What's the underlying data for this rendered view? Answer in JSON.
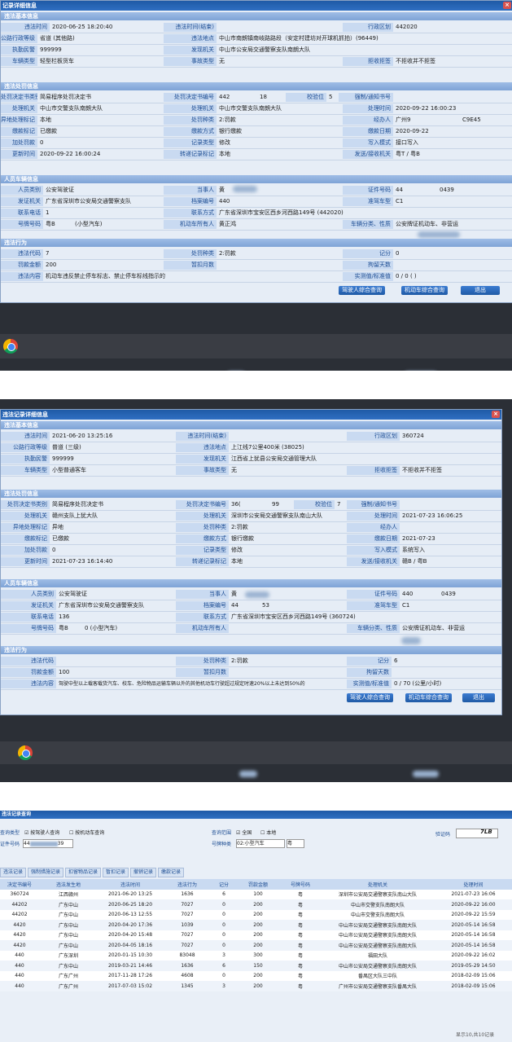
{
  "shot1": {
    "title": "记录详细信息",
    "sections": {
      "basic": "违法基本信息",
      "penalty": "违法处罚信息",
      "person": "人员车辆信息",
      "behavior": "违法行为"
    },
    "violation_time_label": "违法时间",
    "violation_time": "2020-06-25 18:20:40",
    "violation_time_end_label": "违法时间(结束)",
    "admin_area_label": "行政区划",
    "admin_area": "442020",
    "road_level_label": "公路行政等级",
    "road_level": "省道 (其他路)",
    "location_label": "违法地点",
    "location": "中山市南朗镇南岐路路段（安定村建坊对开球机抓拍）(96449)",
    "officer_label": "执勤民警",
    "officer": "999999",
    "found_org_label": "发现机关",
    "found_org": "中山市公安局交通警察支队南朗大队",
    "vehicle_type_label": "车辆类型",
    "vehicle_type": "轻型栏板货车",
    "accident_label": "事故类型",
    "accident": "无",
    "refuse_label": "拒收拒签",
    "refuse": "不拒收并不拒签",
    "decision_type_label": "处罚决定书类别",
    "decision_type": "简易程序处罚决定书",
    "decision_no_label": "处罚决定书编号",
    "decision_no_a": "442",
    "decision_no_b": "18",
    "check_label": "校验位",
    "check": "5",
    "notice_label": "强制/通知书号",
    "handle_org_label": "处理机关",
    "handle_org": "中山市交警支队南朗大队",
    "handle_org2": "中山市交警支队南朗大队",
    "handle_time_label": "处理时间",
    "handle_time": "2020-09-22 16:00:23",
    "remote_label": "异地处理标记",
    "remote": "本地",
    "penalty_kind_label": "处罚种类",
    "penalty_kind": "2:罚款",
    "handler_label": "经办人",
    "handler_a": "广州9",
    "handler_b": "C9E45",
    "pay_flag_label": "缴款标记",
    "pay_flag": "已缴款",
    "pay_method_label": "缴款方式",
    "pay_method": "银行缴款",
    "pay_date_label": "缴款日期",
    "pay_date": "2020-09-22",
    "late_fee_label": "加处罚款",
    "late_fee": "0",
    "record_type_label": "记录类型",
    "record_type": "修改",
    "write_mode_label": "写入模式",
    "write_mode": "接口写入",
    "update_time_label": "更新时间",
    "update_time": "2020-09-22 16:00:24",
    "transfer_label": "转递记录标记",
    "transfer": "本地",
    "send_recv_label": "发送/接收机关",
    "send_recv": "粤T / 粤B",
    "person_type_label": "人员类别",
    "person_type": "公安驾驶证",
    "party_label": "当事人",
    "party": "黄",
    "license_no_label": "证件号码",
    "license_no_a": "44",
    "license_no_b": "0439",
    "issuer_label": "发证机关",
    "issuer": "广东省深圳市公安局交通警察支队",
    "file_no_label": "档案编号",
    "file_no": "440",
    "quasi_label": "准驾车型",
    "quasi": "C1",
    "phone_label": "联系电话",
    "phone": "1",
    "address_label": "联系方式",
    "address": "广东省深圳市宝安区西乡河西路149号 (442020)",
    "plate_label": "号牌号码",
    "plate_a": "粤B",
    "plate_b": "(小型汽车)",
    "owner_label": "机动车所有人",
    "owner": "黄正鸿",
    "usage_label": "车辆分类、性质",
    "usage": "公安牌证机动车、非营运",
    "code_label": "违法代码",
    "code": "7",
    "score_label": "记分",
    "score": "0",
    "penalty_kind2_label": "处罚种类",
    "penalty_kind2": "2:罚款",
    "fine_label": "罚款金额",
    "fine": "200",
    "detain_label": "暂扣月数",
    "detain_days_label": "拘留天数",
    "content_label": "违法内容",
    "content": "机动车违反禁止停车标志、禁止停车标线指示的",
    "measure_label": "实测值/标准值",
    "measure": "0 / 0 ( )",
    "btn_driver": "驾驶人综合查询",
    "btn_vehicle": "机动车综合查询",
    "btn_exit": "退出"
  },
  "shot2": {
    "title": "违法记录详细信息",
    "sections": {
      "basic": "违法基本信息",
      "penalty": "违法处罚信息",
      "person": "人员车辆信息",
      "behavior": "违法行为"
    },
    "violation_time_label": "违法时间",
    "violation_time": "2021-06-20 13:25:16",
    "violation_time_end_label": "违法时间(结束)",
    "admin_area_label": "行政区划",
    "admin_area": "360724",
    "road_level_label": "公路行政等级",
    "road_level": "普道 (三级)",
    "location_label": "违法地点",
    "location": "上江线7公里400米 (38025)",
    "officer_label": "执勤民警",
    "officer": "999999",
    "found_org_label": "发现机关",
    "found_org": "江西省上犹县公安局交通管理大队",
    "vehicle_type_label": "车辆类型",
    "vehicle_type": "小型普通客车",
    "accident_label": "事故类型",
    "accident": "无",
    "refuse_label": "拒收拒签",
    "refuse": "不拒收并不拒签",
    "decision_type_label": "处罚决定书类别",
    "decision_type": "简易程序处罚决定书",
    "decision_no_label": "处罚决定书编号",
    "decision_no_a": "36(",
    "decision_no_b": "99",
    "check_label": "校验位",
    "check": "7",
    "notice_label": "强制/通知书号",
    "handle_org_label": "处理机关",
    "handle_org": "赣州支队上犹大队",
    "handle_org2": "深圳市公安局交通警察支队南山大队",
    "handle_time_label": "处理时间",
    "handle_time": "2021-07-23 16:06:25",
    "remote_label": "异地处理标记",
    "remote": "异地",
    "penalty_kind_label": "处罚种类",
    "penalty_kind": "2:罚款",
    "handler_label": "经办人",
    "pay_flag_label": "缴款标记",
    "pay_flag": "已缴款",
    "pay_method_label": "缴款方式",
    "pay_method": "银行缴款",
    "pay_date_label": "缴款日期",
    "pay_date": "2021-07-23",
    "late_fee_label": "加处罚款",
    "late_fee": "0",
    "record_type_label": "记录类型",
    "record_type": "修改",
    "write_mode_label": "写入模式",
    "write_mode": "系统写入",
    "update_time_label": "更新时间",
    "update_time": "2021-07-23 16:14:40",
    "transfer_label": "转递记录标记",
    "transfer": "本地",
    "send_recv_label": "发送/接收机关",
    "send_recv": "赣B / 粤B",
    "person_type_label": "人员类别",
    "person_type": "公安驾驶证",
    "party_label": "当事人",
    "party": "黄",
    "license_no_label": "证件号码",
    "license_no_a": "440",
    "license_no_b": "0439",
    "issuer_label": "发证机关",
    "issuer": "广东省深圳市公安局交通警察支队",
    "file_no_label": "档案编号",
    "file_no_a": "44",
    "file_no_b": "53",
    "quasi_label": "准驾车型",
    "quasi": "C1",
    "phone_label": "联系电话",
    "phone": "136",
    "address_label": "联系方式",
    "address": "广东省深圳市宝安区西乡河西路149号 (360724)",
    "plate_label": "号牌号码",
    "plate_a": "粤B",
    "plate_b": "0 (小型汽车)",
    "owner_label": "机动车所有人",
    "usage_label": "车辆分类、性质",
    "usage": "公安牌证机动车、非营运",
    "code_label": "违法代码",
    "score_label": "记分",
    "score": "6",
    "penalty_kind2_label": "处罚种类",
    "penalty_kind2": "2:罚款",
    "fine_label": "罚款金额",
    "fine": "100",
    "detain_label": "暂扣月数",
    "detain_days_label": "拘留天数",
    "content_label": "违法内容",
    "content": "驾驶中型以上载客载货汽车、校车、危险物品运输车辆以外的其他机动车行驶超过规定时速20%以上未达到50%的",
    "measure_label": "实测值/标准值",
    "measure": "0 / 70 (公里/小时)",
    "btn_driver": "驾驶人综合查询",
    "btn_vehicle": "机动车综合查询",
    "btn_exit": "退出"
  },
  "shot3": {
    "title": "违法记录查询",
    "query_type_label": "查询类型",
    "opt_driver": "按驾驶人查询",
    "opt_vehicle": "按机动车查询",
    "scope_label": "查询范围",
    "opt_all": "全国",
    "opt_local": "本地",
    "captcha_label": "验证码",
    "captcha": "7LB",
    "license_label": "证件号码",
    "license_a": "44",
    "license_b": "39",
    "plate_type_label": "号牌种类",
    "plate_type": "02:小型汽车",
    "plate_prefix": "粤",
    "tabs": [
      "违法记录",
      "强制措施记录",
      "扣留物品记录",
      "暂扣记录",
      "撤销记录",
      "缴款记录"
    ],
    "headers": [
      "决定书编号",
      "违法发生地",
      "违法时间",
      "违法行为",
      "记分",
      "罚款金额",
      "号牌号码",
      "处理机关",
      "处理时间"
    ],
    "rows": [
      [
        "360724",
        "江西赣州",
        "2021-06-20 13:25",
        "1636",
        "6",
        "100",
        "粤",
        "深圳市公安局交通警察支队南山大队",
        "2021-07-23 16:06"
      ],
      [
        "44202",
        "广东中山",
        "2020-06-25 18:20",
        "7027",
        "0",
        "200",
        "粤",
        "中山市交警支队南朗大队",
        "2020-09-22 16:00"
      ],
      [
        "44202",
        "广东中山",
        "2020-06-13 12:55",
        "7027",
        "0",
        "200",
        "粤",
        "中山市交警支队南朗大队",
        "2020-09-22 15:59"
      ],
      [
        "4420",
        "广东中山",
        "2020-04-20 17:36",
        "1039",
        "0",
        "200",
        "粤",
        "中山市公安局交通警察支队南朗大队",
        "2020-05-14 16:58"
      ],
      [
        "4420",
        "广东中山",
        "2020-04-20 15:48",
        "7027",
        "0",
        "200",
        "粤",
        "中山市公安局交通警察支队南朗大队",
        "2020-05-14 16:58"
      ],
      [
        "4420",
        "广东中山",
        "2020-04-05 18:16",
        "7027",
        "0",
        "200",
        "粤",
        "中山市公安局交通警察支队南朗大队",
        "2020-05-14 16:58"
      ],
      [
        "440",
        "广东深圳",
        "2020-01-15 10:30",
        "83048",
        "3",
        "300",
        "粤",
        "福田大队",
        "2020-09-22 16:02"
      ],
      [
        "440",
        "广东中山",
        "2019-03-21 14:46",
        "1636",
        "6",
        "150",
        "粤",
        "中山市公安局交通警察支队南朗大队",
        "2019-05-29 14:50"
      ],
      [
        "440",
        "广东广州",
        "2017-11-28 17:26",
        "4608",
        "0",
        "200",
        "粤",
        "番禺区大队三中队",
        "2018-02-09 15:06"
      ],
      [
        "440",
        "广东广州",
        "2017-07-03 15:02",
        "1345",
        "3",
        "200",
        "粤",
        "广州市公安局交通警察支队番禺大队",
        "2018-02-09 15:06"
      ]
    ],
    "footer": "显示10,共10记录"
  }
}
